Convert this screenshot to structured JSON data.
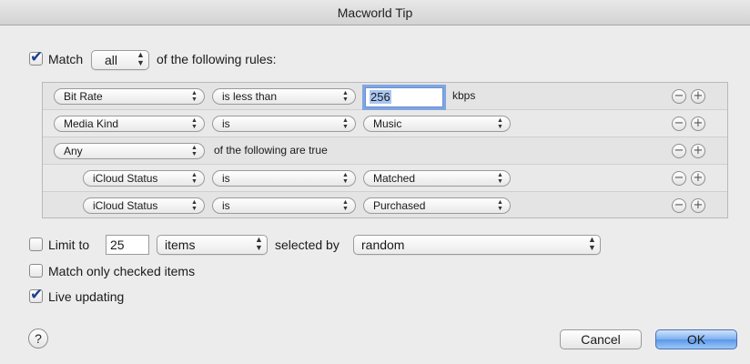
{
  "window": {
    "title": "Macworld Tip"
  },
  "match": {
    "checked": true,
    "label_pre": "Match",
    "quantifier": "all",
    "label_post": "of the following rules:"
  },
  "rules": [
    {
      "field": "Bit Rate",
      "operator": "is less than",
      "value": "256",
      "unit": "kbps"
    },
    {
      "field": "Media Kind",
      "operator": "is",
      "value": "Music"
    },
    {
      "field": "Any",
      "text": "of the following are true"
    },
    {
      "field": "iCloud Status",
      "operator": "is",
      "value": "Matched"
    },
    {
      "field": "iCloud Status",
      "operator": "is",
      "value": "Purchased"
    }
  ],
  "rule_buttons": {
    "remove": "−",
    "add": "+"
  },
  "limit": {
    "checked": false,
    "label": "Limit to",
    "amount": "25",
    "unit": "items",
    "selected_by_label": "selected by",
    "selected_by": "random"
  },
  "match_only_checked": {
    "checked": false,
    "label": "Match only checked items"
  },
  "live_updating": {
    "checked": true,
    "label": "Live updating"
  },
  "buttons": {
    "help": "?",
    "cancel": "Cancel",
    "ok": "OK"
  },
  "colors": {
    "accent": "#5a97ea",
    "focus_ring": "#7fa6e3",
    "selection": "#a8c6f0"
  }
}
